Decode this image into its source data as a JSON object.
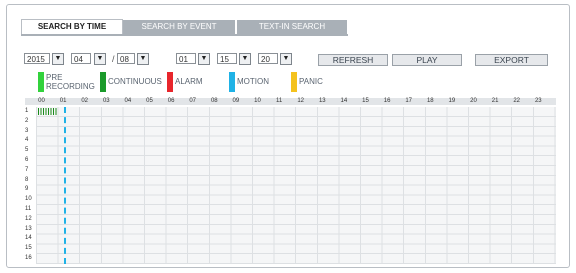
{
  "tabs": [
    {
      "label": "SEARCH BY TIME",
      "active": true
    },
    {
      "label": "SEARCH BY EVENT",
      "active": false
    },
    {
      "label": "TEXT-IN SEARCH",
      "active": false
    }
  ],
  "date": {
    "year": "2015",
    "month": "04",
    "separator": "/",
    "day": "08"
  },
  "time": {
    "hour": "01",
    "minute": "15",
    "second": "20"
  },
  "buttons": {
    "refresh": "REFRESH",
    "play": "PLAY",
    "export": "EXPORT"
  },
  "legend": [
    {
      "label": "PRE\nRECORDING",
      "color": "#32d23c"
    },
    {
      "label": "CONTINUOUS",
      "color": "#1a9a2a"
    },
    {
      "label": "ALARM",
      "color": "#e8262c"
    },
    {
      "label": "MOTION",
      "color": "#1fb2e6"
    },
    {
      "label": "PANIC",
      "color": "#f4c21e"
    }
  ],
  "hours": [
    "00",
    "01",
    "02",
    "03",
    "04",
    "05",
    "06",
    "07",
    "08",
    "09",
    "10",
    "11",
    "12",
    "13",
    "14",
    "15",
    "16",
    "17",
    "18",
    "19",
    "20",
    "21",
    "22",
    "23"
  ],
  "days": [
    "1",
    "2",
    "3",
    "4",
    "5",
    "6",
    "7",
    "8",
    "9",
    "10",
    "11",
    "12",
    "13",
    "14",
    "15",
    "16"
  ],
  "recording": {
    "day": "1",
    "type": "continuous",
    "color": "#1a8a1a"
  },
  "cursor_color": "#1fb2e6"
}
